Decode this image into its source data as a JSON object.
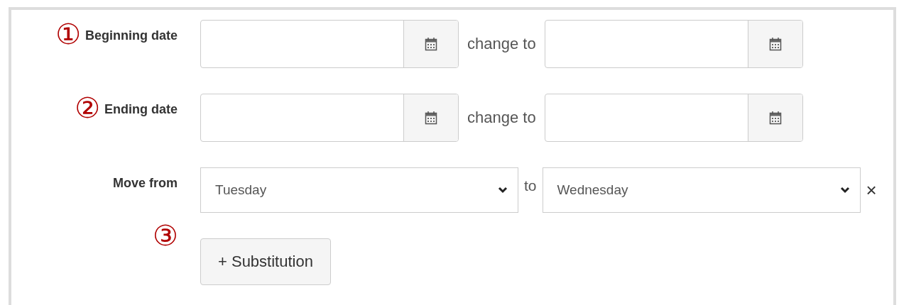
{
  "date_rows": [
    {
      "marker": "①",
      "label": "Beginning date",
      "change_label": "change to"
    },
    {
      "marker": "②",
      "label": "Ending date",
      "change_label": "change to"
    }
  ],
  "substitution": {
    "label": "Move from",
    "from": "Tuesday",
    "connector": "to",
    "to": "Wednesday",
    "remove": "×"
  },
  "add_marker": "③",
  "add_button": "+ Substitution"
}
